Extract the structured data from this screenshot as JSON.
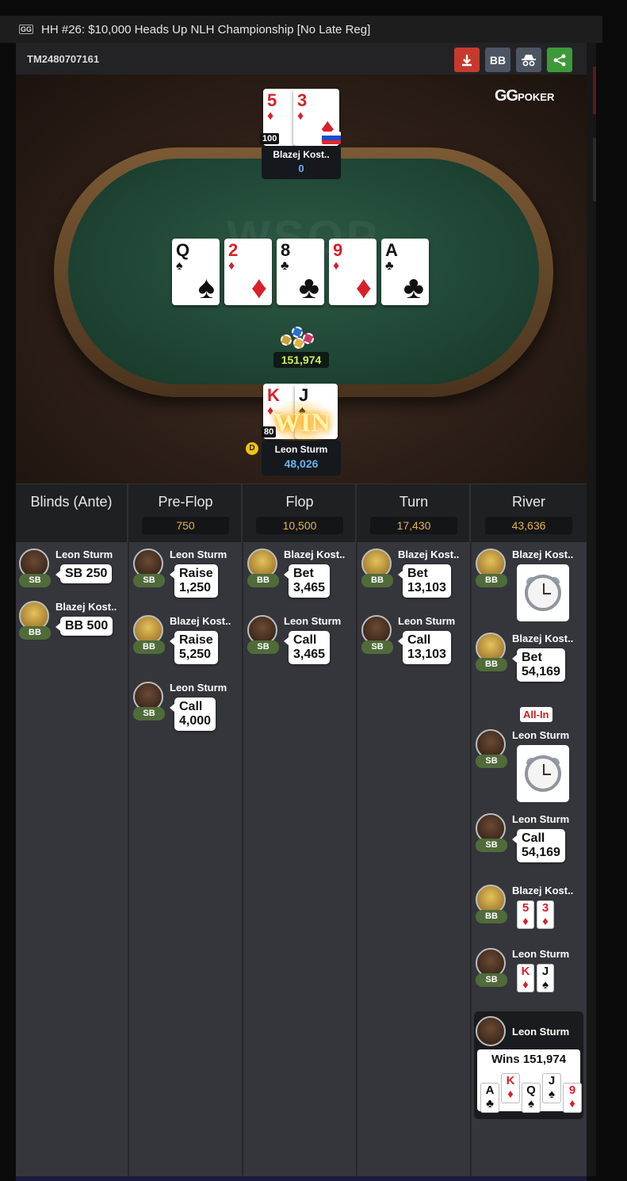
{
  "window": {
    "title": "HH  #26: $10,000 Heads Up NLH Championship [No Late Reg]",
    "logo": "GG"
  },
  "header": {
    "hand_id": "TM2480707161",
    "buttons": {
      "download_icon": "download-icon",
      "bb_label": "BB",
      "spy_icon": "incognito-icon",
      "share_icon": "share-icon"
    }
  },
  "table": {
    "brand": "GG",
    "brand_sub": "POKER",
    "felt_watermark": "WSOP",
    "board": [
      {
        "rank": "Q",
        "suit": "♠",
        "color": "#111111"
      },
      {
        "rank": "2",
        "suit": "♦",
        "color": "#d8202a"
      },
      {
        "rank": "8",
        "suit": "♣",
        "color": "#111111"
      },
      {
        "rank": "9",
        "suit": "♦",
        "color": "#d8202a"
      },
      {
        "rank": "A",
        "suit": "♣",
        "color": "#111111"
      }
    ],
    "pot": "151,974",
    "top_player": {
      "name": "Blazej Kost..",
      "stack": "0",
      "tag": "100",
      "cards": [
        {
          "rank": "5",
          "suit": "♦"
        },
        {
          "rank": "3",
          "suit": "♦"
        }
      ]
    },
    "bottom_player": {
      "name": "Leon Sturm",
      "stack": "48,026",
      "tag": "80",
      "dealer": "D",
      "win_label": "WIN",
      "cards": [
        {
          "rank": "K",
          "suit": "♦"
        },
        {
          "rank": "J",
          "suit": "♠"
        }
      ]
    }
  },
  "streets": [
    {
      "label": "Blinds (Ante)",
      "pot": ""
    },
    {
      "label": "Pre-Flop",
      "pot": "750"
    },
    {
      "label": "Flop",
      "pot": "10,500"
    },
    {
      "label": "Turn",
      "pot": "17,430"
    },
    {
      "label": "River",
      "pot": "43,636"
    }
  ],
  "actions": {
    "blinds": [
      {
        "player": "Leon Sturm",
        "pos": "SB",
        "action": "SB 250"
      },
      {
        "player": "Blazej Kost..",
        "pos": "BB",
        "action": "BB 500"
      }
    ],
    "preflop": [
      {
        "player": "Leon Sturm",
        "pos": "SB",
        "line1": "Raise",
        "line2": "1,250"
      },
      {
        "player": "Blazej Kost..",
        "pos": "BB",
        "line1": "Raise",
        "line2": "5,250"
      },
      {
        "player": "Leon Sturm",
        "pos": "SB",
        "line1": "Call",
        "line2": "4,000"
      }
    ],
    "flop": [
      {
        "player": "Blazej Kost..",
        "pos": "BB",
        "line1": "Bet",
        "line2": "3,465"
      },
      {
        "player": "Leon Sturm",
        "pos": "SB",
        "line1": "Call",
        "line2": "3,465"
      }
    ],
    "turn": [
      {
        "player": "Blazej Kost..",
        "pos": "BB",
        "line1": "Bet",
        "line2": "13,103"
      },
      {
        "player": "Leon Sturm",
        "pos": "SB",
        "line1": "Call",
        "line2": "13,103"
      }
    ],
    "river": [
      {
        "player": "Blazej Kost..",
        "pos": "BB",
        "kind": "timebank"
      },
      {
        "player": "Blazej Kost..",
        "pos": "BB",
        "line1": "Bet",
        "line2": "54,169",
        "tag": "All-In"
      },
      {
        "player": "Leon Sturm",
        "pos": "SB",
        "kind": "timebank"
      },
      {
        "player": "Leon Sturm",
        "pos": "SB",
        "line1": "Call",
        "line2": "54,169"
      },
      {
        "player": "Blazej Kost..",
        "pos": "BB",
        "show": [
          "5",
          "3"
        ]
      },
      {
        "player": "Leon Sturm",
        "pos": "SB",
        "show": [
          "K",
          "J"
        ]
      }
    ],
    "winner": {
      "player": "Leon Sturm",
      "text": "Wins 151,974",
      "cards": [
        "A",
        "K",
        "Q",
        "J",
        "9"
      ]
    }
  }
}
